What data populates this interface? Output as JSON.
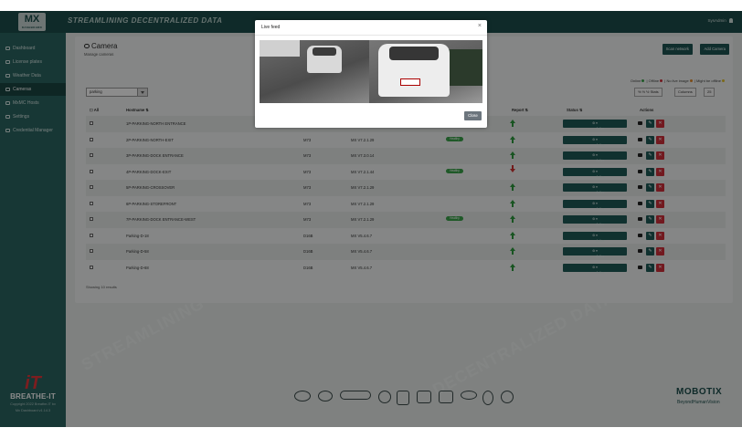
{
  "topbar": {
    "logo_text": "MX",
    "logo_sub": "DASHBOARD",
    "tagline": "STREAMLINING DECENTRALIZED DATA",
    "user": "SysAdmin"
  },
  "sidebar": {
    "items": [
      {
        "label": "Dashboard",
        "icon": "home-icon"
      },
      {
        "label": "License plates",
        "icon": "car-icon"
      },
      {
        "label": "Weather Data",
        "icon": "cloud-icon"
      },
      {
        "label": "Cameras",
        "icon": "camera-icon",
        "active": true
      },
      {
        "label": "MxMC Hosts",
        "icon": "monitor-icon"
      },
      {
        "label": "Settings",
        "icon": "gear-icon"
      },
      {
        "label": "Credential Manager",
        "icon": "key-icon"
      }
    ],
    "brand_name": "BREATHE-IT",
    "copyright": "Copyright 2022 Breathe-IT bv",
    "version": "Mx Dashboard v1.14.3"
  },
  "page": {
    "title": "Camera",
    "subtitle": "Manage cameras",
    "scan_button": "Scan network",
    "add_button": "Add Camera",
    "legend": {
      "online": "Online",
      "offline": "Offline",
      "no_live_image": "No live image",
      "might_be_offline": "Might be offline"
    },
    "filter_value": "parking",
    "column_toggle": "Columns",
    "page_size": "25",
    "column_sort_hint": "% ½ ½ Stats",
    "showing": "Showing 10 results"
  },
  "table": {
    "headers": {
      "all": "All",
      "hostname": "Hostname ⇅",
      "report": "Report ⇅",
      "status": "Status ⇅",
      "actions": "Actions"
    },
    "rows": [
      {
        "hostname": "1P-PARKING-NORTH ENTRANCE",
        "model": "",
        "firmware": "",
        "badge": "",
        "report": "up",
        "status": "Active"
      },
      {
        "hostname": "2P-PARKING-NORTH-EXIT",
        "model": "M73",
        "firmware": "MX V7.2.1.29",
        "badge": "Healthy",
        "report": "up",
        "status": "Active"
      },
      {
        "hostname": "3P-PARKING-DOCK ENTRANCE",
        "model": "M73",
        "firmware": "MX V7.3.0.14",
        "badge": "",
        "report": "up",
        "status": "Active"
      },
      {
        "hostname": "4P-PARKING-DOCK-EXIT",
        "model": "M73",
        "firmware": "MX V7.2.1.44",
        "badge": "Healthy",
        "report": "down",
        "status": "Active"
      },
      {
        "hostname": "5P-PARKING-CROSSOVER",
        "model": "M73",
        "firmware": "MX V7.2.1.29",
        "badge": "",
        "report": "up",
        "status": "Active"
      },
      {
        "hostname": "6P-PARKING-STOREFRONT",
        "model": "M73",
        "firmware": "MX V7.2.1.29",
        "badge": "",
        "report": "up",
        "status": "Active"
      },
      {
        "hostname": "7P-PARKING-DOCK ENTRANCE-WEST",
        "model": "M73",
        "firmware": "MX V7.2.1.29",
        "badge": "Healthy",
        "report": "up",
        "status": "Active"
      },
      {
        "hostname": "Parking-D-18",
        "model": "D16B",
        "firmware": "MX V5.4.6.7",
        "badge": "",
        "report": "up",
        "status": "Active"
      },
      {
        "hostname": "Parking-D-58",
        "model": "D16B",
        "firmware": "MX V5.4.6.7",
        "badge": "",
        "report": "up",
        "status": "Active"
      },
      {
        "hostname": "Parking-D-68",
        "model": "D16B",
        "firmware": "MX V5.4.6.7",
        "badge": "",
        "report": "up",
        "status": "Active"
      }
    ]
  },
  "footer": {
    "mobotix": "MOBOTIX",
    "mobotix_sub": "BeyondHumanVision"
  },
  "modal": {
    "title": "Live feed",
    "close_button": "Close",
    "close_icon": "×"
  },
  "colors": {
    "primary": "#1d4e4c",
    "sidebar": "#2a6461",
    "danger": "#cf2f3a",
    "success": "#3aa24a"
  }
}
